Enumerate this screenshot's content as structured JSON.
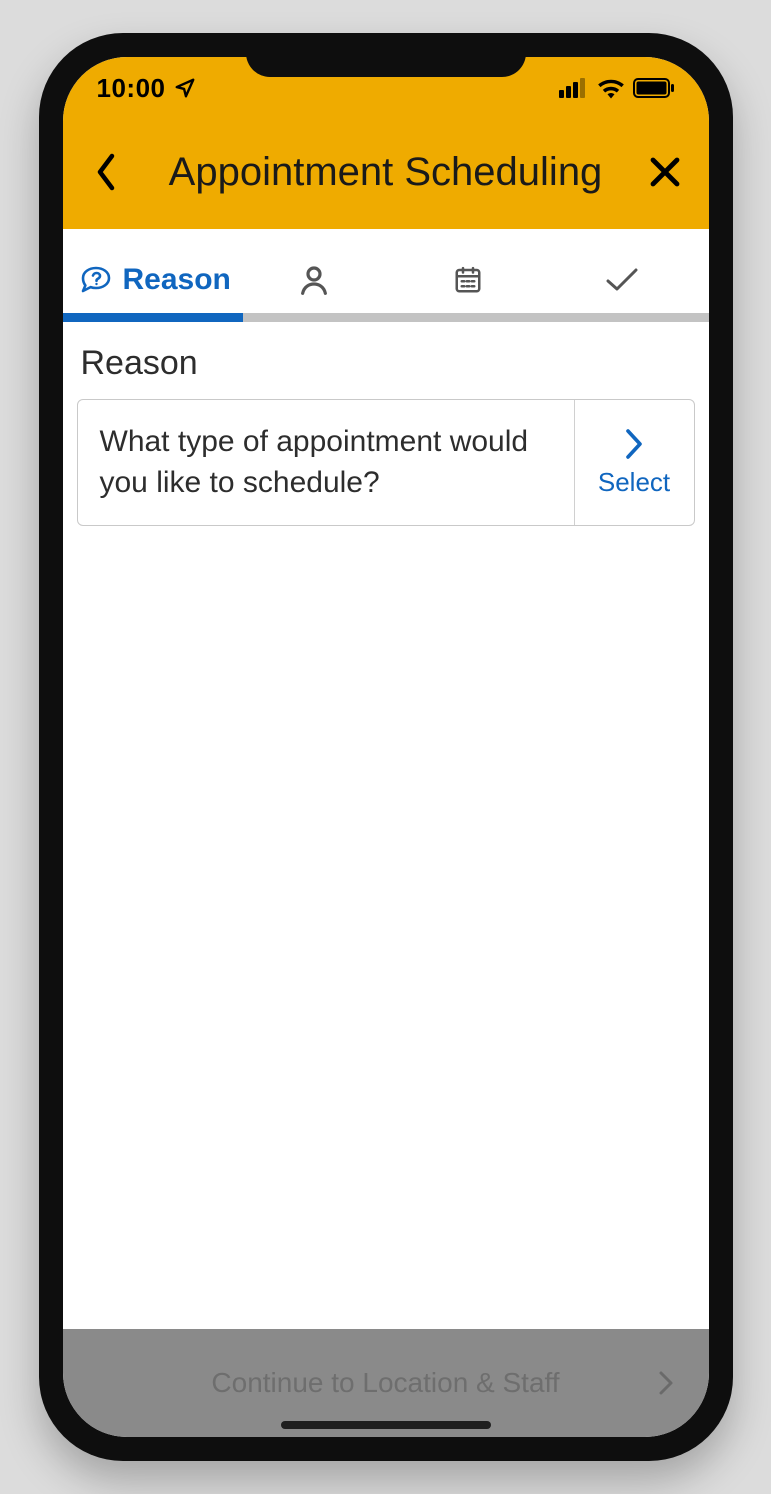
{
  "statusbar": {
    "time": "10:00"
  },
  "header": {
    "title": "Appointment Scheduling"
  },
  "stepper": {
    "steps": [
      {
        "label": "Reason"
      }
    ]
  },
  "content": {
    "section_title": "Reason",
    "card": {
      "question": "What type of appointment would you like to schedule?",
      "select_label": "Select"
    }
  },
  "footer": {
    "continue_label": "Continue to Location & Staff"
  },
  "colors": {
    "accent": "#efab00",
    "primary": "#1066bf"
  }
}
